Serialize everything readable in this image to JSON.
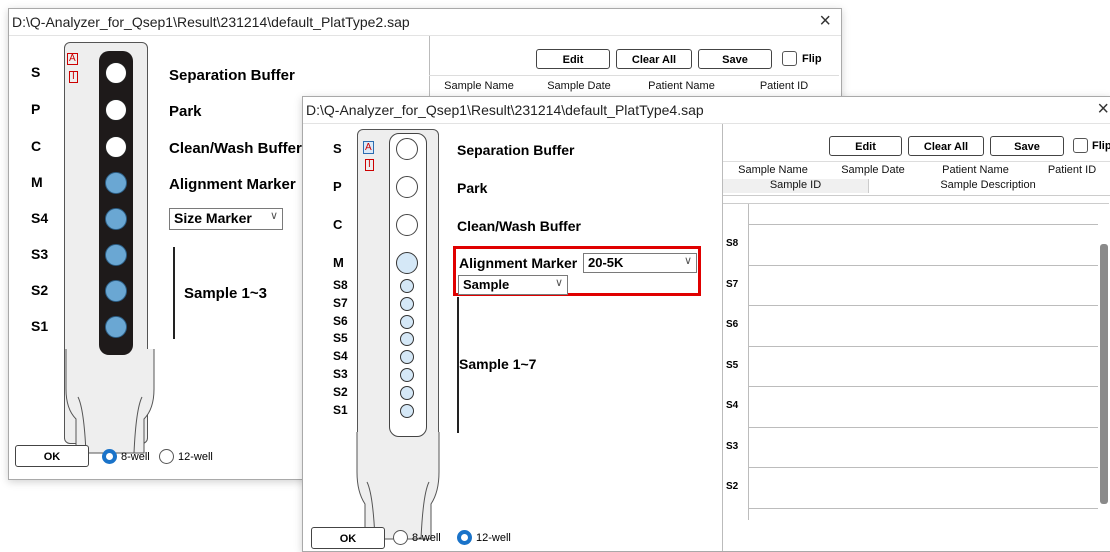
{
  "window1": {
    "title": "D:\\Q-Analyzer_for_Qsep1\\Result\\231214\\default_PlatType2.sap",
    "close_glyph": "×",
    "row_labels": [
      "S",
      "P",
      "C",
      "M",
      "S4",
      "S3",
      "S2",
      "S1"
    ],
    "wells": [
      "white",
      "white",
      "white",
      "blue",
      "blue",
      "blue",
      "blue",
      "blue"
    ],
    "strip_marks": {
      "top": "A",
      "bottom": "I"
    },
    "buffers": {
      "separation": "Separation Buffer",
      "park": "Park",
      "clean": "Clean/Wash Buffer",
      "alignment": "Alignment Marker"
    },
    "size_marker_select": "Size Marker",
    "sample_label": "Sample 1~3",
    "toolbar": {
      "edit": "Edit",
      "clear_all": "Clear All",
      "save": "Save",
      "flip": "Flip"
    },
    "table_headers": [
      "Sample Name",
      "Sample Date",
      "Patient Name",
      "Patient ID"
    ],
    "ok": "OK",
    "radio_8": "8-well",
    "radio_12": "12-well",
    "selected_well": "8-well"
  },
  "window2": {
    "title": "D:\\Q-Analyzer_for_Qsep1\\Result\\231214\\default_PlatType4.sap",
    "close_glyph": "×",
    "row_labels_top": [
      "S",
      "P",
      "C",
      "M"
    ],
    "row_labels_samples": [
      "S8",
      "S7",
      "S6",
      "S5",
      "S4",
      "S3",
      "S2",
      "S1"
    ],
    "strip_marks": {
      "top": "A",
      "bottom": "I"
    },
    "buffers": {
      "separation": "Separation Buffer",
      "park": "Park",
      "clean": "Clean/Wash Buffer"
    },
    "alignment_label": "Alignment Marker",
    "alignment_select": "20-5K",
    "sample_select": "Sample",
    "sample_label": "Sample 1~7",
    "toolbar": {
      "edit": "Edit",
      "clear_all": "Clear All",
      "save": "Save",
      "flip": "Flip"
    },
    "table_headers_row1": [
      "Sample Name",
      "Sample Date",
      "Patient Name",
      "Patient ID"
    ],
    "table_headers_row2": [
      "Sample ID",
      "Sample Description"
    ],
    "table_rows": [
      "S8",
      "S7",
      "S6",
      "S5",
      "S4",
      "S3",
      "S2"
    ],
    "ok": "OK",
    "radio_8": "8-well",
    "radio_12": "12-well",
    "selected_well": "12-well",
    "highlight_color": "#e00000"
  },
  "colors": {
    "accent": "#1a73c9",
    "well_blue": "#6aa7d3",
    "well_lightblue": "#d5e8f7"
  }
}
